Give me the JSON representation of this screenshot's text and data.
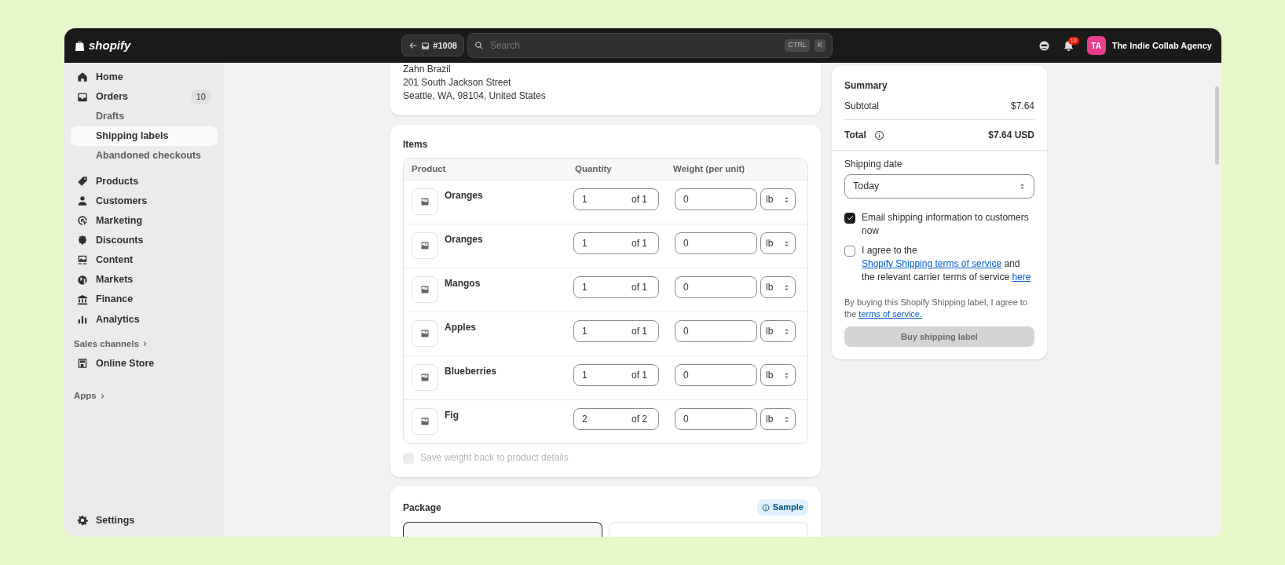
{
  "topbar": {
    "logo": "shopify",
    "order_ref": "#1008",
    "search": {
      "placeholder": "Search"
    },
    "shortcut": [
      "CTRL",
      "K"
    ],
    "notifications": "10",
    "avatar": "TA",
    "store": "The Indie Collab Agency"
  },
  "sidebar": {
    "items": [
      {
        "label": "Home",
        "selected": false
      },
      {
        "label": "Orders",
        "badge": "10",
        "selected": false,
        "children": [
          {
            "label": "Drafts",
            "selected": false
          },
          {
            "label": "Shipping labels",
            "selected": true
          },
          {
            "label": "Abandoned checkouts",
            "selected": false
          }
        ]
      },
      {
        "label": "Products",
        "selected": false
      },
      {
        "label": "Customers",
        "selected": false
      },
      {
        "label": "Marketing",
        "selected": false
      },
      {
        "label": "Discounts",
        "selected": false
      },
      {
        "label": "Content",
        "selected": false
      },
      {
        "label": "Markets",
        "selected": false
      },
      {
        "label": "Finance",
        "selected": false
      },
      {
        "label": "Analytics",
        "selected": false
      }
    ],
    "sections": [
      {
        "title": "Sales channels",
        "items": [
          {
            "label": "Online Store",
            "selected": false
          }
        ]
      },
      {
        "title": "Apps"
      }
    ],
    "settings": "Settings"
  },
  "address": [
    "Zahn Brazil",
    "201 South Jackson Street",
    "Seattle, WA, 98104, United States"
  ],
  "items": {
    "title": "Items",
    "columns": [
      "Product",
      "Quantity",
      "Weight (per unit)"
    ],
    "rows": [
      {
        "product": "Oranges",
        "quantity": "1",
        "of": "of 1",
        "weight": "0",
        "unit": "lb"
      },
      {
        "product": "Oranges",
        "quantity": "1",
        "of": "of 1",
        "weight": "0",
        "unit": "lb"
      },
      {
        "product": "Mangos",
        "quantity": "1",
        "of": "of 1",
        "weight": "0",
        "unit": "lb"
      },
      {
        "product": "Apples",
        "quantity": "1",
        "of": "of 1",
        "weight": "0",
        "unit": "lb"
      },
      {
        "product": "Blueberries",
        "quantity": "1",
        "of": "of 1",
        "weight": "0",
        "unit": "lb"
      },
      {
        "product": "Fig",
        "quantity": "2",
        "of": "of 2",
        "weight": "0",
        "unit": "lb"
      }
    ],
    "save_weight": {
      "label": "Save weight back to product details",
      "checked": false,
      "disabled": true
    }
  },
  "package": {
    "title": "Package",
    "badge": "Sample"
  },
  "summary": {
    "title": "Summary",
    "subtotal_label": "Subtotal",
    "subtotal": "$7.64",
    "total_label": "Total",
    "total": "$7.64 USD",
    "shipping_date_label": "Shipping date",
    "shipping_date": "Today",
    "email": {
      "label": "Email shipping information to customers now",
      "checked": true
    },
    "agree": {
      "checked": false,
      "parts": [
        {
          "kind": "text",
          "text": "I agree to the"
        },
        {
          "kind": "link",
          "text": "Shopify Shipping terms of service"
        },
        {
          "kind": "text",
          "text": "and the relevant carrier terms of service"
        },
        {
          "kind": "link",
          "text": "here"
        }
      ]
    },
    "notice": [
      {
        "kind": "text",
        "text": "By buying this Shopify Shipping label, I agree to the"
      },
      {
        "kind": "link",
        "text": "terms of service."
      }
    ],
    "buy_button": {
      "label": "Buy shipping label",
      "disabled": true
    }
  }
}
